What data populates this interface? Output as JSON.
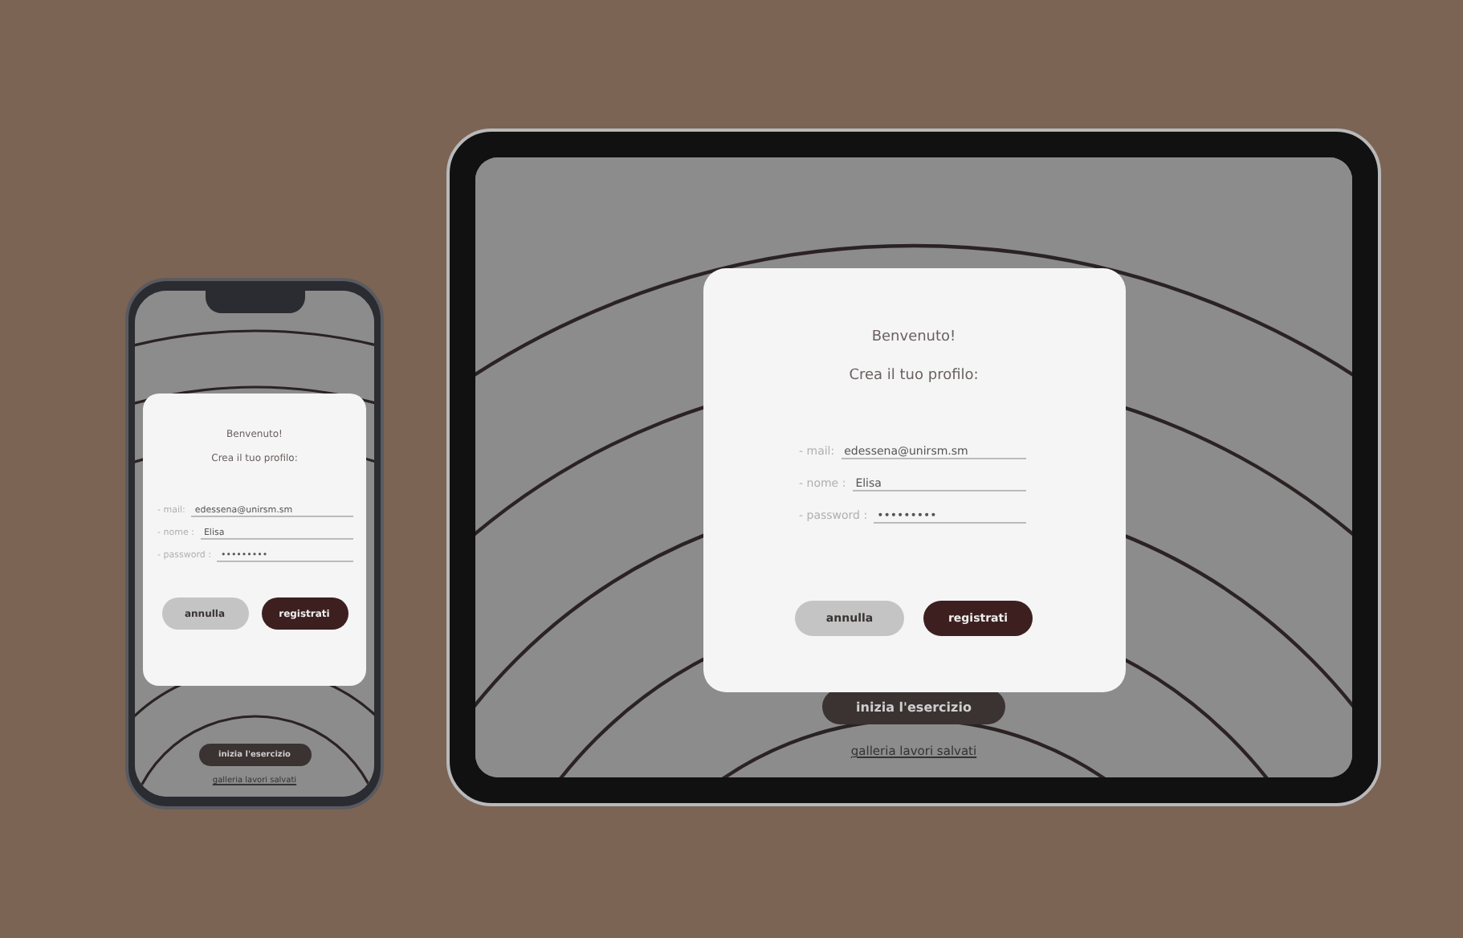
{
  "devices": [
    {
      "kind": "phone",
      "screen": {
        "dialog": {
          "title": "Benvenuto!",
          "subtitle": "Crea il tuo profilo:",
          "fields": [
            {
              "label": "- mail:",
              "value": "edessena@unirsm.sm"
            },
            {
              "label": "- nome :",
              "value": "Elisa"
            },
            {
              "label": "- password :",
              "value": "•••••••••"
            }
          ],
          "buttons": [
            {
              "label": "annulla",
              "kind": "secondary"
            },
            {
              "label": "registrati",
              "kind": "primary"
            }
          ]
        },
        "start_button": "inizia l'esercizio",
        "gallery_link": "galleria lavori salvati"
      }
    },
    {
      "kind": "tablet",
      "screen": {
        "dialog": {
          "title": "Benvenuto!",
          "subtitle": "Crea il tuo profilo:",
          "fields": [
            {
              "label": "- mail:",
              "value": "edessena@unirsm.sm"
            },
            {
              "label": "- nome :",
              "value": "Elisa"
            },
            {
              "label": "- password :",
              "value": "•••••••••"
            }
          ],
          "buttons": [
            {
              "label": "annulla",
              "kind": "secondary"
            },
            {
              "label": "registrati",
              "kind": "primary"
            }
          ]
        },
        "start_button": "inizia l'esercizio",
        "gallery_link": "galleria lavori salvati"
      }
    }
  ]
}
